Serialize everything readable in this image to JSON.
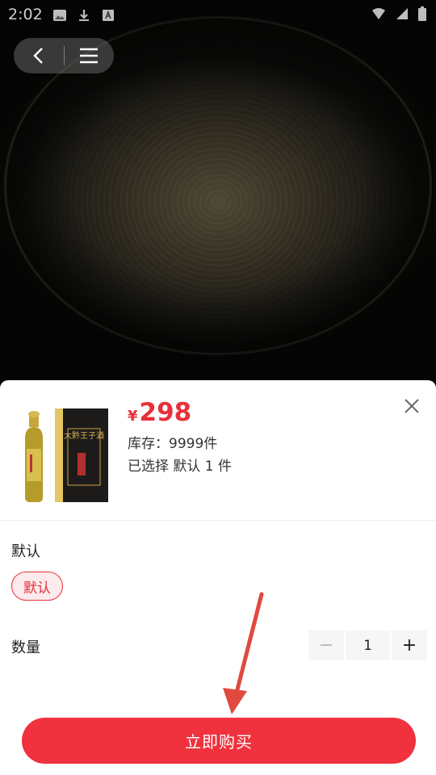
{
  "status_bar": {
    "time": "2:02"
  },
  "product": {
    "currency_symbol": "¥",
    "price": "298",
    "stock_text": "库存：9999件",
    "selected_text": "已选择 默认 1 件",
    "bottle_label": "大黔王子酒"
  },
  "spec": {
    "title": "默认",
    "options": [
      "默认"
    ]
  },
  "quantity": {
    "label": "数量",
    "value": "1",
    "minus": "−",
    "plus": "+"
  },
  "buy_button": {
    "label": "立即购买"
  },
  "colors": {
    "accent": "#f0313e",
    "price": "#e8303a",
    "chip_bg": "#fdeaec"
  }
}
